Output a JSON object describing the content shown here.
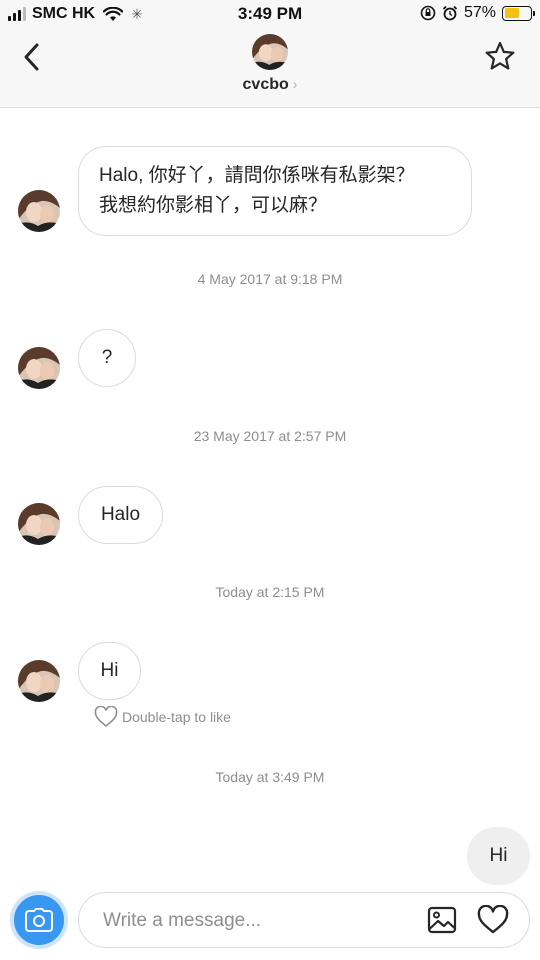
{
  "status_bar": {
    "carrier": "SMC HK",
    "time": "3:49 PM",
    "battery_percent": "57%",
    "battery_level": 0.57,
    "battery_color": "#f4c114"
  },
  "header": {
    "username": "cvcbo",
    "chevron": "›",
    "back_icon": "chevron-left-icon",
    "star_icon": "star-icon"
  },
  "messages": [
    {
      "direction": "in",
      "text_lines": [
        "Halo, 你好丫，請問你係咪有私影架？",
        "我想約你影相丫，可以麻？"
      ]
    },
    {
      "timestamp": "4 May 2017 at 9:18 PM"
    },
    {
      "direction": "in",
      "text": "?"
    },
    {
      "timestamp": "23 May 2017 at 2:57 PM"
    },
    {
      "direction": "in",
      "text": "Halo"
    },
    {
      "timestamp": "Today at 2:15 PM"
    },
    {
      "direction": "in",
      "text": "Hi"
    },
    {
      "hint": "Double-tap to like"
    },
    {
      "timestamp": "Today at 3:49 PM"
    },
    {
      "direction": "out",
      "text": "Hi"
    }
  ],
  "composer": {
    "placeholder": "Write a message...",
    "accent_color": "#3897f0"
  }
}
